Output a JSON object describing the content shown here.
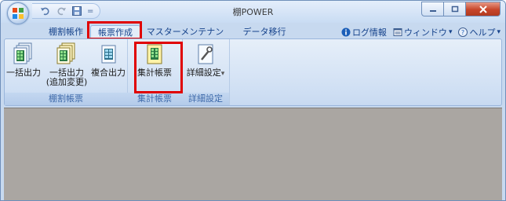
{
  "window": {
    "title": "棚POWER"
  },
  "qat": {
    "items": [
      "undo-icon",
      "redo-icon",
      "save-icon",
      "customize-icon"
    ],
    "dropdown_glyph": "="
  },
  "system_buttons": {
    "minimize": "minimize-icon",
    "maximize": "maximize-icon",
    "close": "close-icon"
  },
  "tabs": [
    {
      "label": "棚割帳作"
    },
    {
      "label": "帳票作成",
      "active": true
    },
    {
      "label": "マスターメンテナンス"
    },
    {
      "label": "データ移行"
    }
  ],
  "right_menu": {
    "log_info": "ログ情報",
    "window": "ウィンドウ",
    "help": "ヘルプ",
    "dropdown": "▾"
  },
  "ribbon": {
    "groups": [
      {
        "label": "棚割帳票",
        "buttons": [
          {
            "label": "一括出力",
            "icon": "batch-output-icon"
          },
          {
            "label": "一括出力",
            "label2": "(追加変更)",
            "icon": "batch-output-add-icon"
          },
          {
            "label": "複合出力",
            "icon": "combined-output-icon"
          }
        ]
      },
      {
        "label": "集計帳票",
        "buttons": [
          {
            "label": "集計帳票",
            "icon": "summary-report-icon"
          }
        ]
      },
      {
        "label": "詳細設定",
        "buttons": [
          {
            "label": "詳細設定",
            "dropdown": "▾",
            "icon": "detail-settings-icon"
          }
        ]
      }
    ]
  },
  "highlight_color": "#e00000"
}
